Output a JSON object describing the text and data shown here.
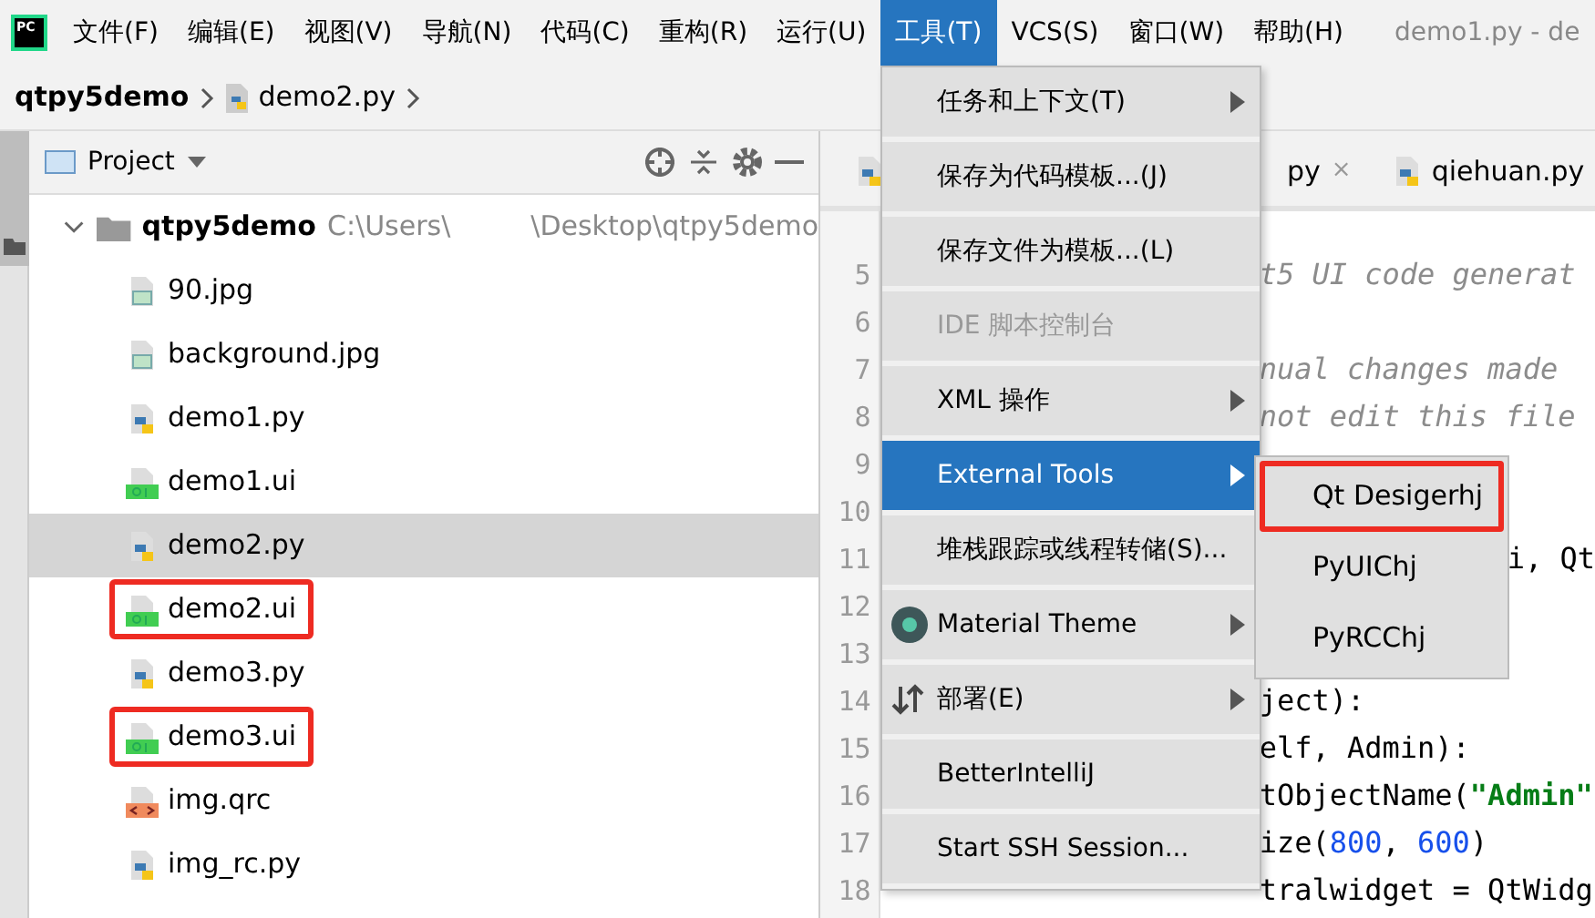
{
  "menubar": {
    "logo": "PC",
    "items": [
      {
        "label": "文件(F)",
        "selected": false
      },
      {
        "label": "编辑(E)",
        "selected": false
      },
      {
        "label": "视图(V)",
        "selected": false
      },
      {
        "label": "导航(N)",
        "selected": false
      },
      {
        "label": "代码(C)",
        "selected": false
      },
      {
        "label": "重构(R)",
        "selected": false
      },
      {
        "label": "运行(U)",
        "selected": false
      },
      {
        "label": "工具(T)",
        "selected": true
      },
      {
        "label": "VCS(S)",
        "selected": false
      },
      {
        "label": "窗口(W)",
        "selected": false
      },
      {
        "label": "帮助(H)",
        "selected": false
      }
    ],
    "window_title": "demo1.py - de"
  },
  "breadcrumb": [
    "qtpy5demo",
    "demo2.py"
  ],
  "project_panel": {
    "title": "Project",
    "root": {
      "label": "qtpy5demo",
      "path": "C:\\Users\\",
      "path_tail": "\\Desktop\\qtpy5demo",
      "expanded": true,
      "children": [
        {
          "label": "90.jpg",
          "kind": "image",
          "selected": false,
          "highlighted": false
        },
        {
          "label": "background.jpg",
          "kind": "image",
          "selected": false,
          "highlighted": false
        },
        {
          "label": "demo1.py",
          "kind": "python",
          "selected": false,
          "highlighted": false
        },
        {
          "label": "demo1.ui",
          "kind": "qt",
          "selected": false,
          "highlighted": false
        },
        {
          "label": "demo2.py",
          "kind": "python",
          "selected": true,
          "highlighted": false
        },
        {
          "label": "demo2.ui",
          "kind": "qt",
          "selected": false,
          "highlighted": true
        },
        {
          "label": "demo3.py",
          "kind": "python",
          "selected": false,
          "highlighted": false
        },
        {
          "label": "demo3.ui",
          "kind": "qt",
          "selected": false,
          "highlighted": true
        },
        {
          "label": "img.qrc",
          "kind": "qrc",
          "selected": false,
          "highlighted": false
        },
        {
          "label": "img_rc.py",
          "kind": "python",
          "selected": false,
          "highlighted": false
        }
      ]
    }
  },
  "editor": {
    "tabs": [
      {
        "label": "py",
        "close": "×",
        "selected": false
      },
      {
        "label": "qiehuan.py",
        "selected": false
      }
    ],
    "lines": [
      {
        "number": "5",
        "code": "t5 UI code generat",
        "kind": "comment"
      },
      {
        "number": "6",
        "kind": "plain"
      },
      {
        "number": "7",
        "code": "nual changes made",
        "kind": "comment"
      },
      {
        "number": "8",
        "code": "not edit this file",
        "kind": "comment"
      },
      {
        "number": "9",
        "kind": "plain"
      },
      {
        "number": "10",
        "kind": "plain"
      },
      {
        "number": "11",
        "code": "i, Qt",
        "kind": "plain"
      },
      {
        "number": "12",
        "kind": "plain"
      },
      {
        "number": "13",
        "kind": "plain"
      },
      {
        "number": "14",
        "code": "ject):",
        "kind": "plain"
      },
      {
        "number": "15",
        "code": "elf, Admin):",
        "kind": "plain"
      },
      {
        "number": "16",
        "code": "tObjectName(**\"Admin\"**",
        "kind": "plain"
      },
      {
        "number": "17",
        "code": "ize(800, 600)",
        "kind": "number"
      },
      {
        "number": "18",
        "code": "tralwidget = QtWidg",
        "kind": "plain"
      }
    ]
  },
  "tools_menu": {
    "items": [
      {
        "label": "任务和上下文(T)",
        "submenu": true,
        "disabled": false,
        "selected": false,
        "kind": "plain"
      },
      {
        "label": "保存为代码模板...(J)",
        "submenu": false,
        "disabled": false,
        "selected": false,
        "kind": "plain"
      },
      {
        "label": "保存文件为模板...(L)",
        "submenu": false,
        "disabled": false,
        "selected": false,
        "kind": "plain"
      },
      {
        "label": "IDE 脚本控制台",
        "submenu": false,
        "disabled": true,
        "selected": false,
        "kind": "plain"
      },
      {
        "label": "XML 操作",
        "submenu": true,
        "disabled": false,
        "selected": false,
        "kind": "plain"
      },
      {
        "label": "External Tools",
        "submenu": true,
        "disabled": false,
        "selected": true,
        "kind": "plain"
      },
      {
        "label": "堆栈跟踪或线程转储(S)...",
        "submenu": false,
        "disabled": false,
        "selected": false,
        "kind": "plain"
      },
      {
        "label": "Material Theme",
        "submenu": true,
        "disabled": false,
        "selected": false,
        "kind": "theme"
      },
      {
        "label": "部署(E)",
        "submenu": true,
        "disabled": false,
        "selected": false,
        "kind": "deploy"
      },
      {
        "label": "BetterIntelliJ",
        "submenu": false,
        "disabled": false,
        "selected": false,
        "kind": "plain"
      },
      {
        "label": "Start SSH Session...",
        "submenu": false,
        "disabled": false,
        "selected": false,
        "kind": "plain"
      }
    ]
  },
  "external_tools_menu": {
    "items": [
      {
        "label": "Qt Desigerhj",
        "highlighted": true
      },
      {
        "label": "PyUIChj",
        "highlighted": false
      },
      {
        "label": "PyRCChj",
        "highlighted": false
      }
    ]
  }
}
